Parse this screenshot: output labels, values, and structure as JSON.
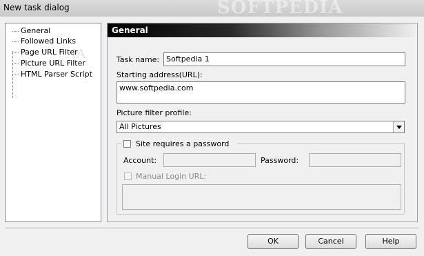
{
  "window": {
    "title": "New task dialog",
    "watermark": "SOFTPEDIA"
  },
  "tree": {
    "items": [
      {
        "label": "General",
        "selected": true
      },
      {
        "label": "Followed Links"
      },
      {
        "label": "Page URL Filter"
      },
      {
        "label": "Picture URL Filter"
      },
      {
        "label": "HTML Parser Script"
      }
    ],
    "watermark": "IA"
  },
  "panel": {
    "header": "General",
    "task_name_label": "Task name:",
    "task_name_value": "Softpedia 1",
    "starting_address_label": "Starting address(URL):",
    "starting_address_value": "www.softpedia.com",
    "picture_filter_label": "Picture filter profile:",
    "picture_filter_value": "All Pictures",
    "password_group": {
      "checkbox_label": "Site requires a password",
      "checked": false,
      "account_label": "Account:",
      "account_value": "",
      "password_label": "Password:",
      "password_value": "",
      "manual_login_label": "Manual Login URL:",
      "manual_login_checked": false,
      "manual_login_value": ""
    }
  },
  "buttons": {
    "ok": "OK",
    "cancel": "Cancel",
    "help": "Help"
  }
}
